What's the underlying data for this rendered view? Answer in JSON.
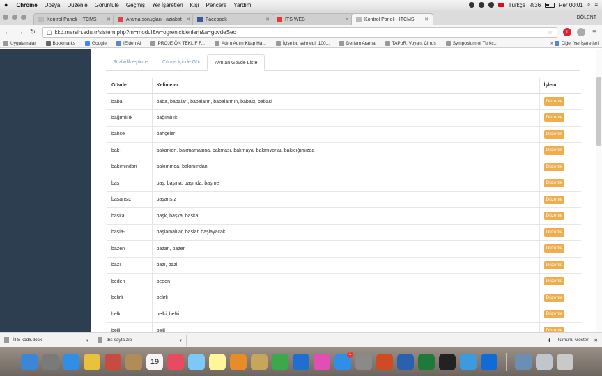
{
  "menubar": {
    "apple": "",
    "app": "Chrome",
    "items": [
      "Dosya",
      "Düzenle",
      "Görüntüle",
      "Geçmiş",
      "Yer İşaretleri",
      "Kişi",
      "Pencere",
      "Yardım"
    ],
    "language": "Türkçe",
    "battery": "%36",
    "clock": "Per 00:01"
  },
  "tabs": [
    {
      "title": "Kontrol Paneli - İTCMS",
      "active": false
    },
    {
      "title": "Arama sonuçları - aziabat",
      "active": false
    },
    {
      "title": "Facebook",
      "active": false
    },
    {
      "title": "İTS WEB",
      "active": false
    },
    {
      "title": "Kontrol Paneli - İTCMS",
      "active": true
    }
  ],
  "profile_name": "DÖLENT",
  "toolbar": {
    "url": "kkd.mersin.edu.tr/sistem.php?m=modul&w=ogrenicidenlem&a=govdeSec",
    "ext_label": "t"
  },
  "bookmarks": {
    "items": [
      "Uygulamalar",
      "Bookmarks",
      "Google",
      "IE'den Al",
      "PROJE ÖN TEKLİF F...",
      "Adım Adım Kitap Ha...",
      "İçişe bu sehnedir 100...",
      "Derlem Arama",
      "TAPoR: Voyant Cirrus",
      "Symposium of Turkc..."
    ],
    "other": "Diğer Yer İşaretleri"
  },
  "page_tabs": [
    "Sözbirlikleştirme",
    "Cümle İçinde Gör",
    "Ayrılan Gövde Liste"
  ],
  "table": {
    "headers": [
      "Gövde",
      "Kelimeler",
      "İşlem"
    ],
    "edit_label": "Düzenle",
    "rows": [
      {
        "stem": "baba",
        "words": "baba, babaları, babaların, babalarının, babası, babasi"
      },
      {
        "stem": "bağımlılık",
        "words": "bağımlılık"
      },
      {
        "stem": "bahçe",
        "words": "bahçeler"
      },
      {
        "stem": "bak-",
        "words": "bakarken, bakmamasına, bakması, bakmaya, bakmıyorlar, bakıcığımızda"
      },
      {
        "stem": "bakımından",
        "words": "bakımında, bakımından"
      },
      {
        "stem": "baş",
        "words": "baş, başına, başında, başıne"
      },
      {
        "stem": "başarısız",
        "words": "başarısız"
      },
      {
        "stem": "başka",
        "words": "başk, başka, başka"
      },
      {
        "stem": "başla-",
        "words": "başlamalılar, başlar, başlayacak"
      },
      {
        "stem": "bazen",
        "words": "bazan, bazen"
      },
      {
        "stem": "bazı",
        "words": "bazı, bazi"
      },
      {
        "stem": "beden",
        "words": "beden"
      },
      {
        "stem": "belirli",
        "words": "belirli"
      },
      {
        "stem": "belki",
        "words": "belki, belki"
      },
      {
        "stem": "belli",
        "words": "belli"
      }
    ]
  },
  "downloads": {
    "items": [
      "İTS kodlr.docx",
      "tbs sayfa.zip"
    ],
    "show_all": "Tümünü Göster"
  },
  "dock": {
    "calendar_day": "19",
    "badge": "1",
    "apps": [
      "finder",
      "launchpad",
      "safari",
      "chrome",
      "mail",
      "notes",
      "calendar",
      "photos",
      "messages",
      "stickies",
      "photos2",
      "keynote-like",
      "numbers",
      "keynote",
      "itunes",
      "appstore",
      "settings",
      "powerpoint",
      "word",
      "excel",
      "terminal",
      "network",
      "teamviewer",
      "preview",
      "finder2",
      "trash"
    ],
    "colors": [
      "#3b86d6",
      "#7a7a7a",
      "#2f8fe6",
      "#e9c23b",
      "#c94b3f",
      "#b08d57",
      "#f5f5f5",
      "#e84a5f",
      "#7ec8f8",
      "#fff59a",
      "#e98c27",
      "#c7a65b",
      "#3aa84b",
      "#1e6fcf",
      "#e24fb2",
      "#2f8fe6",
      "#8a8a8a",
      "#d04a24",
      "#2b5fb0",
      "#1f7a3a",
      "#222222",
      "#3c9be0",
      "#0f6bd6",
      "#6b8fb3",
      "#bfc6cc",
      "#c9c9c9"
    ]
  }
}
